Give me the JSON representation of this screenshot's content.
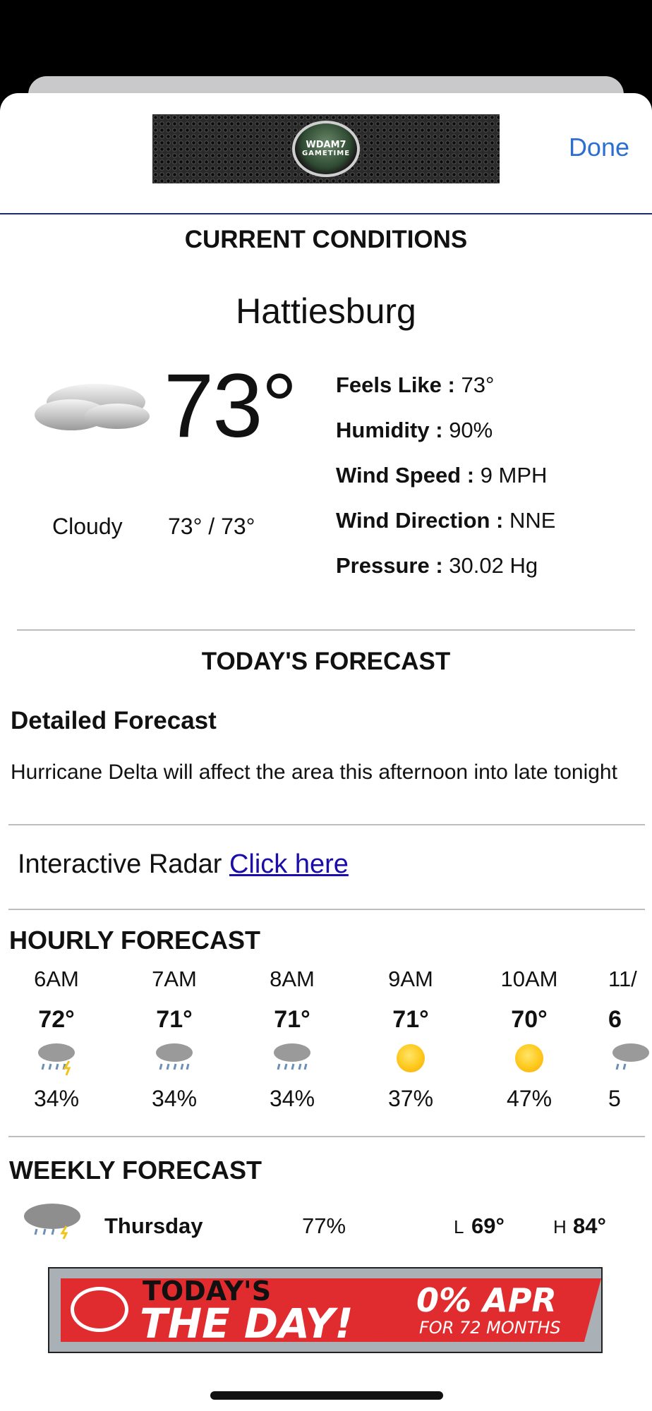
{
  "header": {
    "logo_text_line1": "WDAM7",
    "logo_text_line2": "GAMETIME",
    "done_label": "Done"
  },
  "current": {
    "section_title": "CURRENT CONDITIONS",
    "city": "Hattiesburg",
    "temperature": "73°",
    "condition": "Cloudy",
    "hi_lo": "73° / 73°",
    "icon": "cloud-icon",
    "stats": [
      {
        "label": "Feels Like :",
        "value": "73°"
      },
      {
        "label": "Humidity :",
        "value": "90%"
      },
      {
        "label": "Wind Speed :",
        "value": "9 MPH"
      },
      {
        "label": "Wind Direction :",
        "value": "NNE"
      },
      {
        "label": "Pressure :",
        "value": "30.02 Hg"
      }
    ]
  },
  "today": {
    "section_title": "TODAY'S FORECAST",
    "detailed_title": "Detailed Forecast",
    "detailed_text": "Hurricane Delta will affect the area this afternoon into late tonight",
    "radar_label": "Interactive Radar",
    "radar_link": "Click here"
  },
  "hourly": {
    "section_title": "HOURLY FORECAST",
    "hours": [
      {
        "time": "6AM",
        "temp": "72°",
        "icon": "thunderstorm-icon",
        "precip": "34%"
      },
      {
        "time": "7AM",
        "temp": "71°",
        "icon": "rain-icon",
        "precip": "34%"
      },
      {
        "time": "8AM",
        "temp": "71°",
        "icon": "rain-icon",
        "precip": "34%"
      },
      {
        "time": "9AM",
        "temp": "71°",
        "icon": "sun-icon",
        "precip": "37%"
      },
      {
        "time": "10AM",
        "temp": "70°",
        "icon": "sun-icon",
        "precip": "47%"
      },
      {
        "time": "11/",
        "temp": "6",
        "icon": "rain-icon",
        "precip": "5"
      }
    ]
  },
  "weekly": {
    "section_title": "WEEKLY FORECAST",
    "rows": [
      {
        "day": "Thursday",
        "precip": "77%",
        "low_label": "L",
        "low": "69°",
        "high_label": "H",
        "high": "84°",
        "icon": "thunderstorm-icon"
      }
    ]
  },
  "ad": {
    "line1": "TODAY'S",
    "line2": "THE DAY!",
    "offer": "0% APR",
    "offer_sub": "FOR 72 MONTHS",
    "logo": "toyota-logo-icon"
  },
  "colors": {
    "link_blue": "#2d6fd0",
    "ad_red": "#e12c2f",
    "header_rule": "#1f2a6b"
  }
}
